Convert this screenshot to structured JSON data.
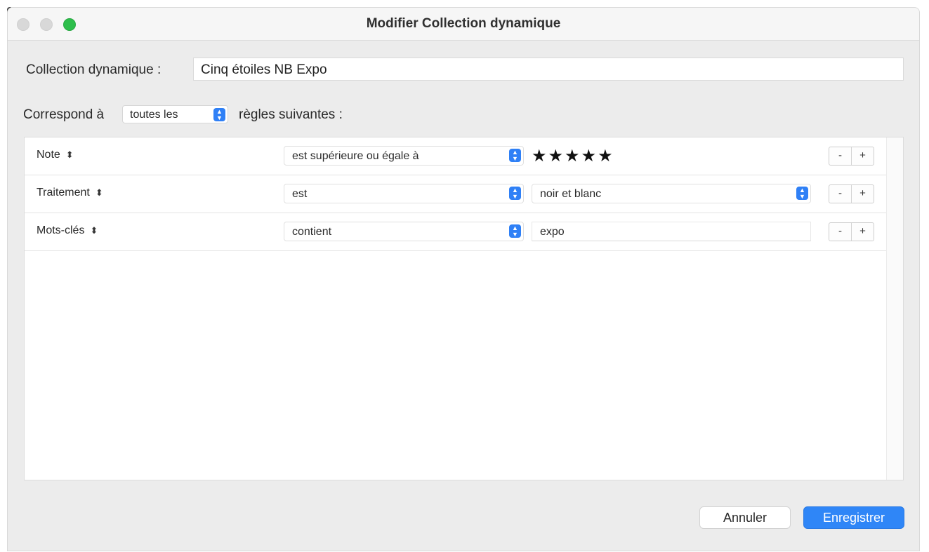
{
  "window": {
    "title": "Modifier Collection dynamique"
  },
  "name_field": {
    "label": "Collection dynamique :",
    "value": "Cinq étoiles NB Expo"
  },
  "match": {
    "prefix": "Correspond à",
    "selected": "toutes les",
    "suffix": "règles suivantes :"
  },
  "rules": [
    {
      "field": "Note",
      "operator": "est supérieure ou égale à",
      "value_type": "rating",
      "value": "★★★★★",
      "rating": 5,
      "remove_label": "-",
      "add_label": "+"
    },
    {
      "field": "Traitement",
      "operator": "est",
      "value_type": "select",
      "value": "noir et blanc",
      "remove_label": "-",
      "add_label": "+"
    },
    {
      "field": "Mots-clés",
      "operator": "contient",
      "value_type": "text",
      "value": "expo",
      "remove_label": "-",
      "add_label": "+"
    }
  ],
  "buttons": {
    "cancel": "Annuler",
    "save": "Enregistrer"
  },
  "icons": {
    "field_stepper": "up-down-arrows-icon",
    "select_stepper": "select-stepper-icon"
  },
  "colors": {
    "accent": "#2f86f7",
    "zoom_button": "#2dbe4b"
  }
}
